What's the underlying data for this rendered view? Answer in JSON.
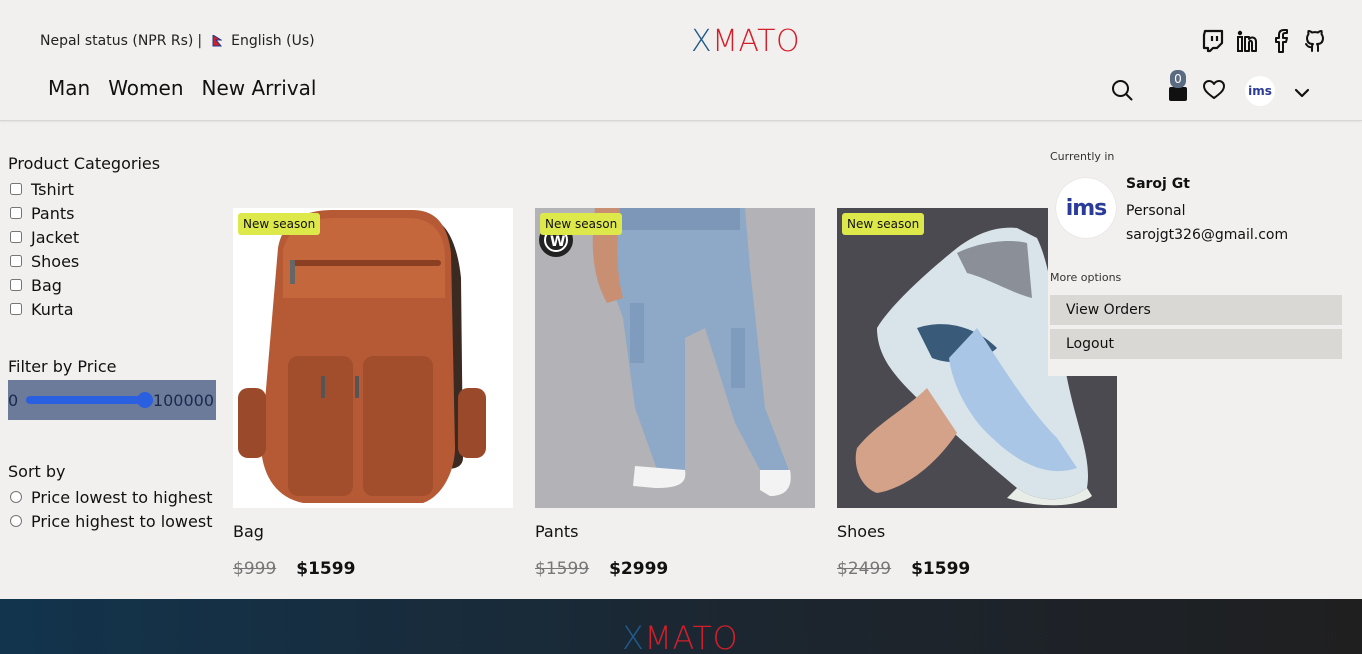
{
  "header": {
    "status_text": "Nepal status (NPR Rs)",
    "separator": "|",
    "language": "English (Us)",
    "logo_x": "X",
    "logo_rest": "MATO",
    "nav": [
      "Man",
      "Women",
      "New Arrival"
    ],
    "cart_count": "0",
    "avatar_text": "ims",
    "social_icons": [
      "twitch-icon",
      "linkedin-icon",
      "facebook-icon",
      "github-icon"
    ]
  },
  "sidebar": {
    "categories_title": "Product Categories",
    "categories": [
      "Tshirt",
      "Pants",
      "Jacket",
      "Shoes",
      "Bag",
      "Kurta"
    ],
    "price_title": "Filter by Price",
    "price_min": "0",
    "price_max": "100000",
    "sort_title": "Sort by",
    "sort_options": [
      "Price lowest to highest",
      "Price highest to lowest"
    ]
  },
  "products": [
    {
      "badge": "New season",
      "name": "Bag",
      "old_price": "$999",
      "price": "$1599"
    },
    {
      "badge": "New season",
      "name": "Pants",
      "old_price": "$1599",
      "price": "$2999"
    },
    {
      "badge": "New season",
      "name": "Shoes",
      "old_price": "$2499",
      "price": "$1599"
    }
  ],
  "dropdown": {
    "currently_in": "Currently in",
    "avatar_text": "ims",
    "name": "Saroj Gt",
    "account_type": "Personal",
    "email": "sarojgt326@gmail.com",
    "more_options": "More options",
    "view_orders": "View Orders",
    "logout": "Logout"
  },
  "footer": {
    "logo_x": "X",
    "logo_rest": "MATO"
  },
  "colors": {
    "background": "#f2f0ee",
    "badge": "#dde84a",
    "logo_x": "#1e5a8c",
    "logo_rest": "#d21f2a",
    "slider_track": "#2a5fe0"
  }
}
